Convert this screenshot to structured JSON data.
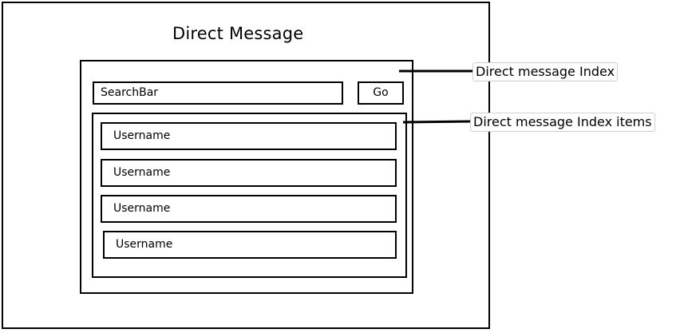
{
  "page": {
    "title": "Direct Message"
  },
  "search": {
    "placeholder": "SearchBar",
    "go_label": "Go"
  },
  "items": [
    {
      "label": "Username"
    },
    {
      "label": "Username"
    },
    {
      "label": "Username"
    },
    {
      "label": "Username"
    }
  ],
  "annotations": {
    "index_label": "Direct message Index",
    "items_label": "Direct message Index items"
  }
}
